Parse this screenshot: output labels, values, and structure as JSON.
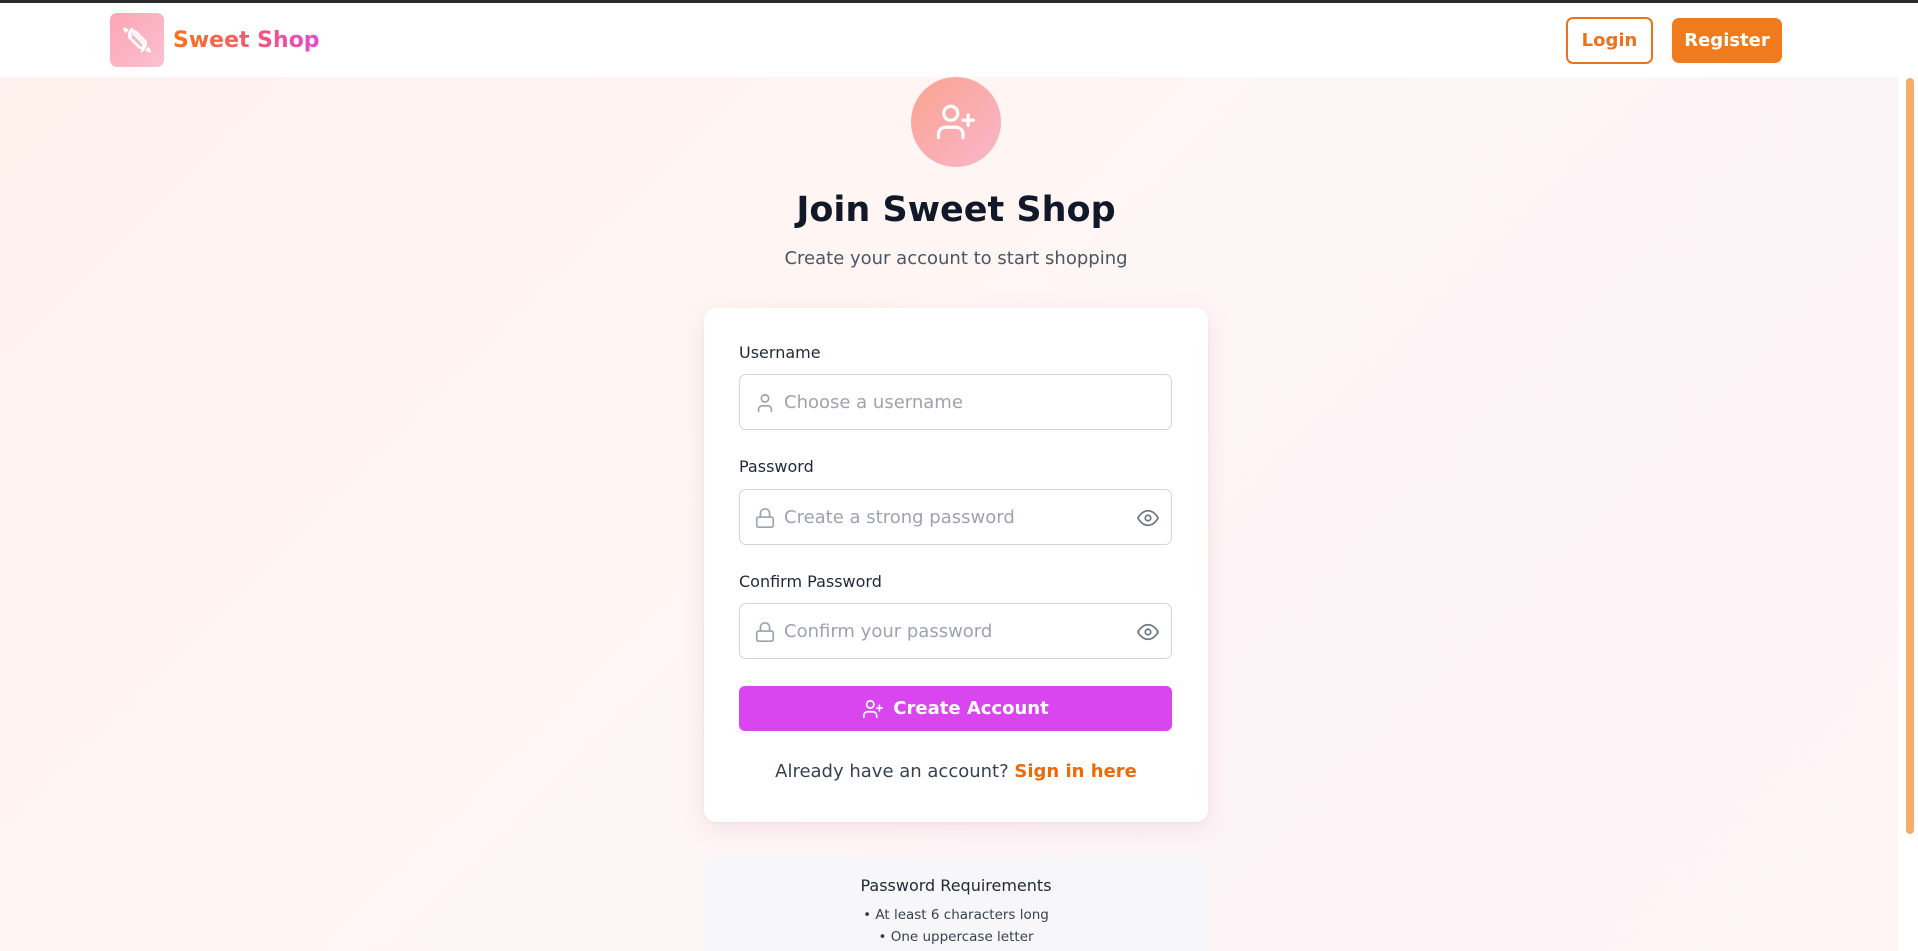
{
  "header": {
    "brand_name": "Sweet Shop",
    "login_label": "Login",
    "register_label": "Register"
  },
  "hero": {
    "icon": "user-plus-icon",
    "title": "Join Sweet Shop",
    "subtitle": "Create your account to start shopping"
  },
  "form": {
    "username": {
      "label": "Username",
      "placeholder": "Choose a username",
      "value": "",
      "icon": "user-icon"
    },
    "password": {
      "label": "Password",
      "placeholder": "Create a strong password",
      "value": "",
      "icon": "lock-icon",
      "toggle_icon": "eye-icon"
    },
    "confirm_password": {
      "label": "Confirm Password",
      "placeholder": "Confirm your password",
      "value": "",
      "icon": "lock-icon",
      "toggle_icon": "eye-icon"
    },
    "submit_label": "Create Account",
    "submit_icon": "user-plus-icon",
    "signin_prompt": "Already have an account?",
    "signin_link": "Sign in here"
  },
  "requirements": {
    "title": "Password Requirements",
    "items": [
      "• At least 6 characters long",
      "• One uppercase letter"
    ]
  },
  "colors": {
    "accent_orange": "#f07b1c",
    "accent_magenta": "#d946ef",
    "link_orange": "#ea6a0c"
  }
}
